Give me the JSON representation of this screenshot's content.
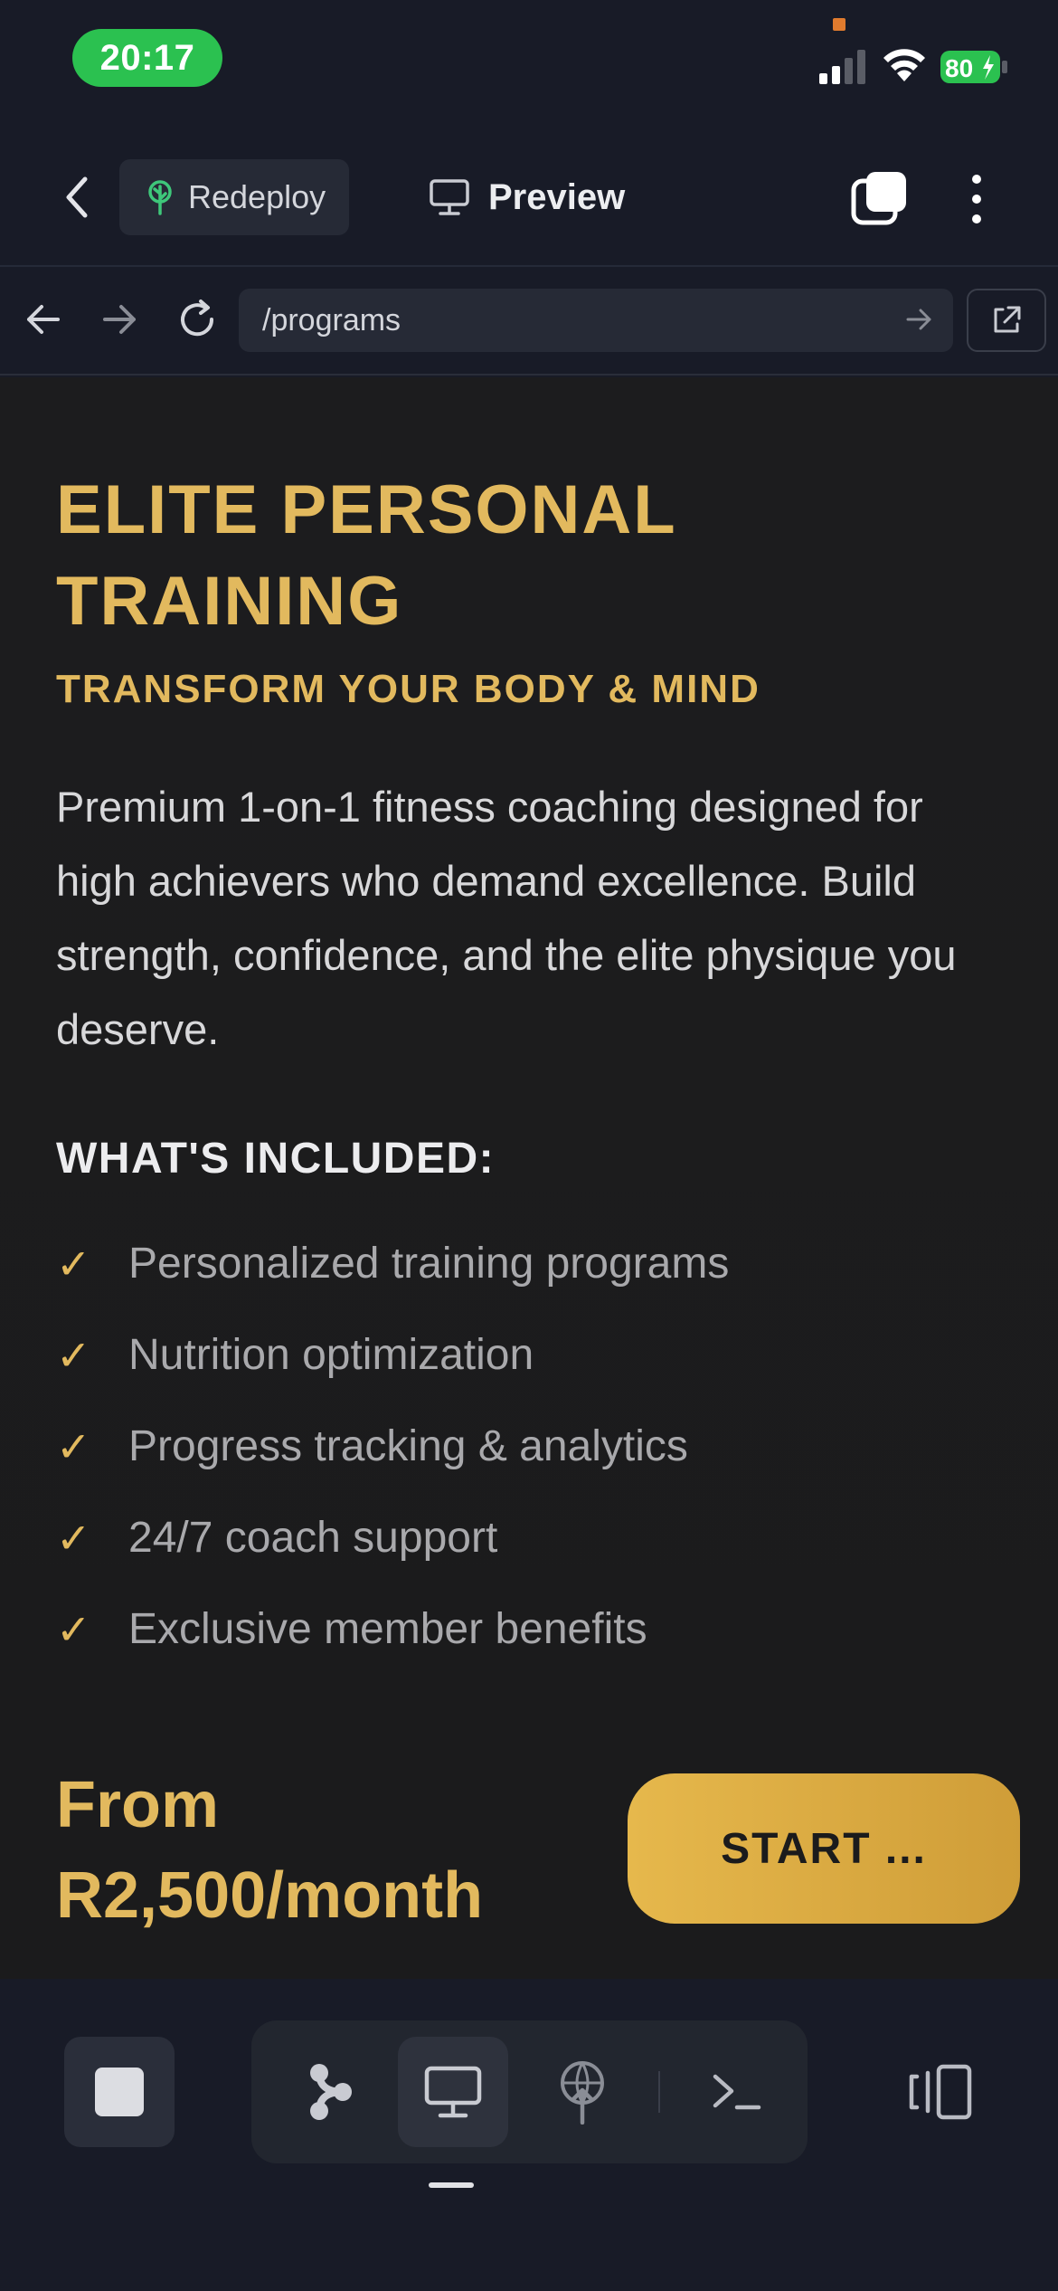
{
  "status_bar": {
    "time": "20:17",
    "battery": "80",
    "colors": {
      "time_pill": "#2bc150",
      "battery_fill": "#2bc150"
    }
  },
  "header": {
    "back_icon": "chevron-left-icon",
    "redeploy_label": "Redeploy",
    "redeploy_icon": "deploy-tree-icon",
    "preview_label": "Preview",
    "preview_icon": "monitor-icon",
    "tabs_icon": "tabs-icon",
    "more_icon": "more-vertical-icon"
  },
  "browser": {
    "url": "/programs",
    "back_icon": "arrow-left-icon",
    "forward_icon": "arrow-right-icon",
    "reload_icon": "reload-icon",
    "go_icon": "arrow-right-icon",
    "external_icon": "external-link-icon"
  },
  "page": {
    "title": "ELITE PERSONAL TRAINING",
    "subtitle": "TRANSFORM YOUR BODY & MIND",
    "description": "Premium 1-on-1 fitness coaching designed for high achievers who demand excellence. Build strength, confidence, and the elite physique you deserve.",
    "included_heading": "WHAT'S INCLUDED:",
    "features": [
      "Personalized training programs",
      "Nutrition optimization",
      "Progress tracking & analytics",
      "24/7 coach support",
      "Exclusive member benefits"
    ],
    "check_glyph": "✓",
    "price": "From R2,500/month",
    "cta_label": "START ...",
    "colors": {
      "accent": "#e2b95e",
      "background": "#1c1c1e"
    }
  },
  "toolbar": {
    "stop_icon": "stop-icon",
    "tools": [
      "branch-icon",
      "monitor-icon",
      "deploy-icon",
      "terminal-icon"
    ],
    "active_tool": "monitor-icon",
    "panel_icon": "panel-toggle-icon"
  }
}
